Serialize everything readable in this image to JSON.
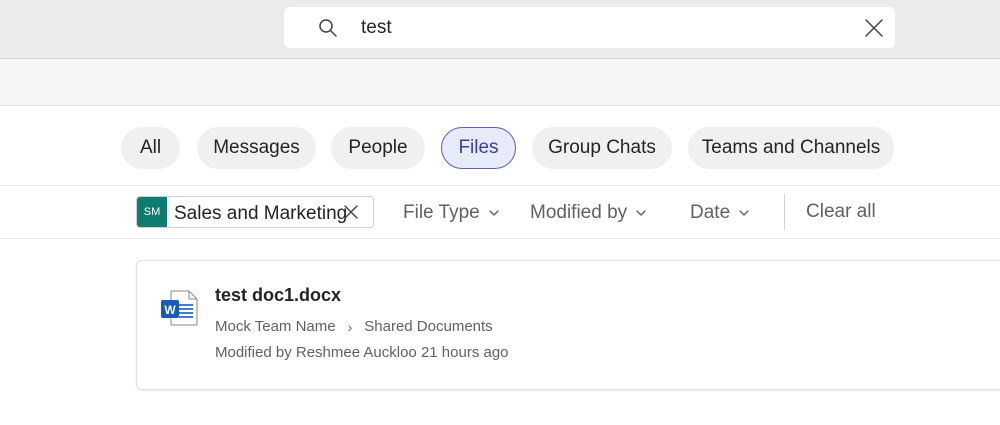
{
  "search": {
    "value": "test",
    "search_icon": "search-icon",
    "clear_icon": "close-icon"
  },
  "tabs": [
    {
      "label": "All",
      "active": false
    },
    {
      "label": "Messages",
      "active": false
    },
    {
      "label": "People",
      "active": false
    },
    {
      "label": "Files",
      "active": true
    },
    {
      "label": "Group Chats",
      "active": false
    },
    {
      "label": "Teams and Channels",
      "active": false
    }
  ],
  "filters": {
    "scope": {
      "initials": "SM",
      "label": "Sales and Marketing",
      "avatar_color": "#0f7c70"
    },
    "file_type": "File Type",
    "modified_by": "Modified by",
    "date": "Date",
    "clear_all": "Clear all"
  },
  "results": [
    {
      "file_name": "test doc1.docx",
      "icon": "word-document-icon",
      "path": [
        "Mock Team Name",
        "Shared Documents"
      ],
      "modified": "Modified by Reshmee Auckloo 21 hours ago"
    }
  ],
  "colors": {
    "accent": "#5b5fc7",
    "active_tab_bg": "#e8ebfa",
    "word_blue": "#185abd"
  }
}
